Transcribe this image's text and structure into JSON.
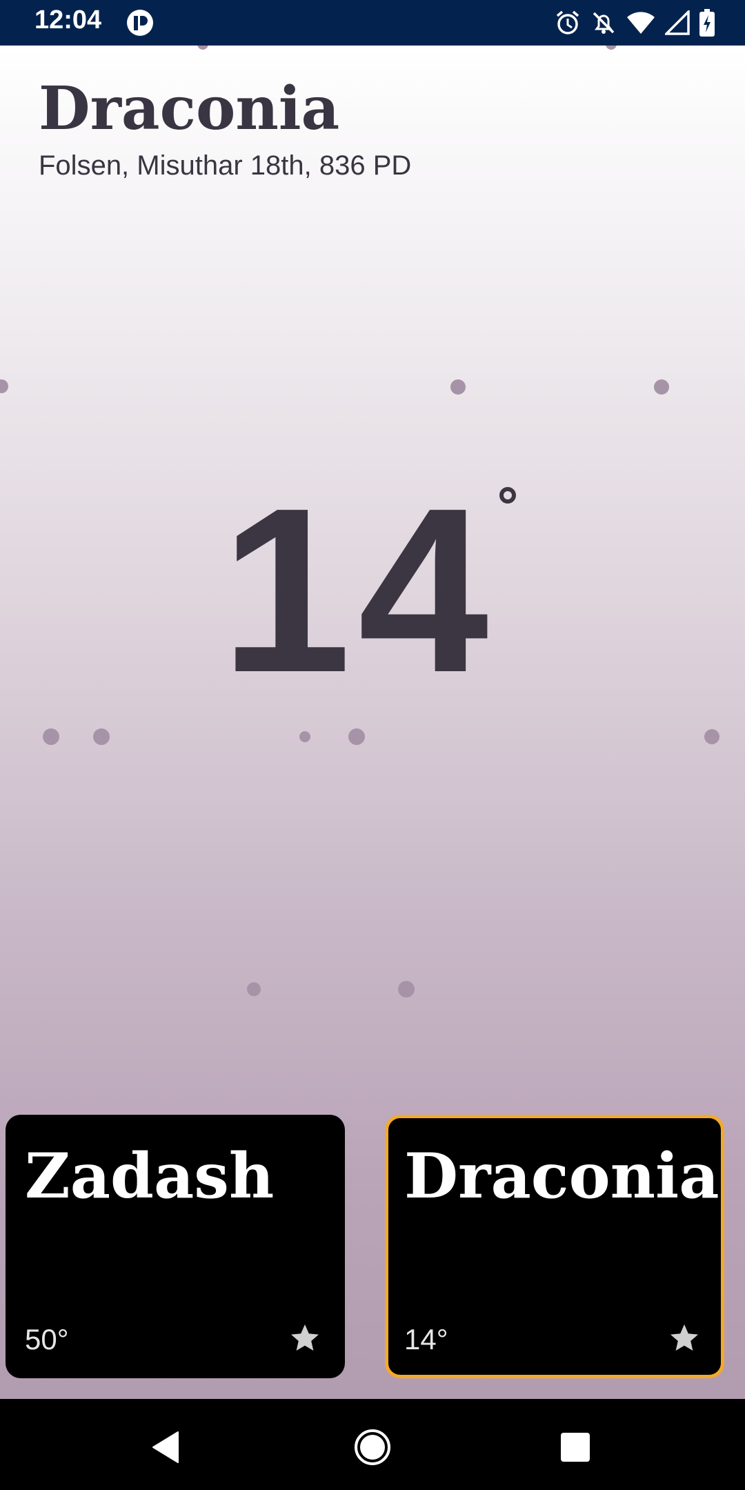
{
  "status_bar": {
    "time": "12:04",
    "icons": [
      "app-notification-icon",
      "alarm-icon",
      "notifications-off-icon",
      "wifi-icon",
      "signal-icon",
      "battery-charging-icon"
    ]
  },
  "header": {
    "city": "Draconia",
    "date": "Folsen, Misuthar 18th, 836 PD"
  },
  "current": {
    "temperature": "14"
  },
  "cards": [
    {
      "name": "Zadash",
      "temperature": "50°",
      "selected": false,
      "icon": "star-icon"
    },
    {
      "name": "Draconia",
      "temperature": "14°",
      "selected": true,
      "icon": "star-icon"
    }
  ],
  "nav": [
    "back-icon",
    "home-icon",
    "recents-icon"
  ],
  "colors": {
    "status_bar": "#03234e",
    "selected_border": "#f2a92c",
    "text_dark": "#3a3542"
  }
}
